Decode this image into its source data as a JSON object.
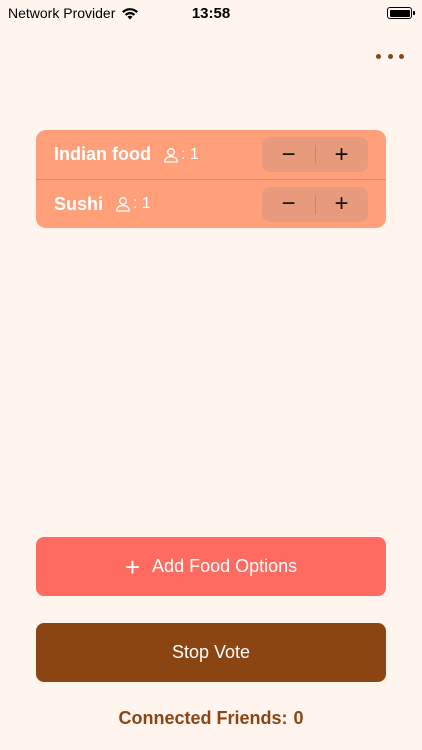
{
  "status_bar": {
    "carrier": "Network Provider",
    "time": "13:58"
  },
  "food_options": [
    {
      "name": "Indian food",
      "votes_label": ": 1",
      "decrement": "−",
      "increment": "+"
    },
    {
      "name": "Sushi",
      "votes_label": ": 1",
      "decrement": "−",
      "increment": "+"
    }
  ],
  "actions": {
    "add_plus": "+",
    "add_label": "Add Food Options",
    "stop_label": "Stop Vote"
  },
  "footer": {
    "connected_label": "Connected Friends:",
    "connected_count": "0"
  },
  "colors": {
    "background": "#FFF4EE",
    "card": "#FFA07A",
    "add_button": "#FF6B60",
    "stop_button": "#8B4513",
    "accent_text": "#8B4513"
  }
}
